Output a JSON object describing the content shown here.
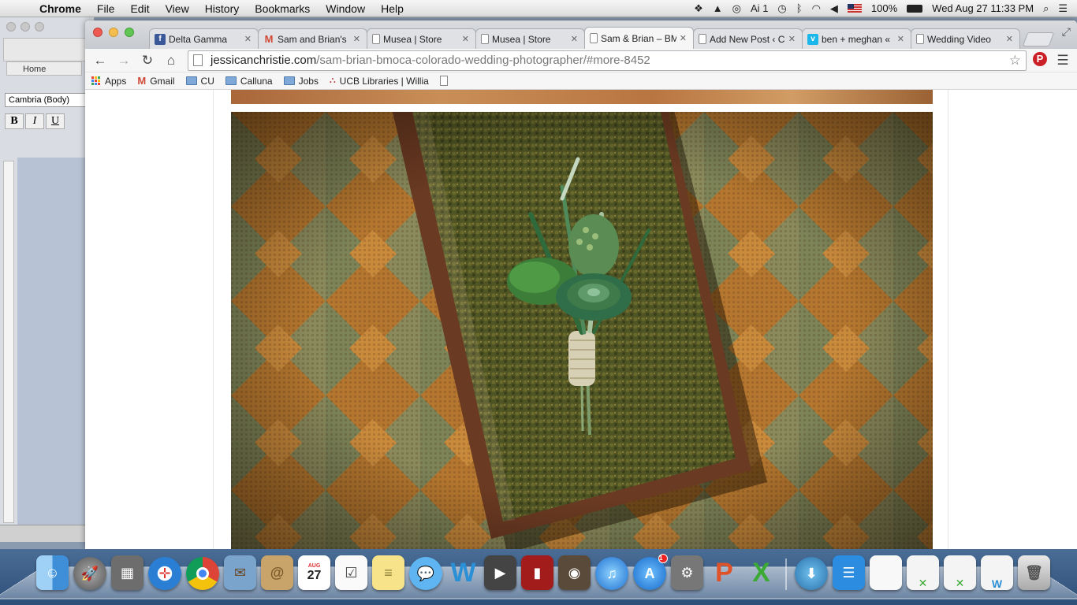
{
  "menubar": {
    "app_name": "Chrome",
    "menus": [
      "File",
      "Edit",
      "View",
      "History",
      "Bookmarks",
      "Window",
      "Help"
    ],
    "adobe_count": "1",
    "battery": "100%",
    "clock": "Wed Aug 27  11:33 PM"
  },
  "word": {
    "home_label": "Home",
    "font_name": "Cambria (Body)",
    "format_buttons": [
      "B",
      "I",
      "U"
    ]
  },
  "tabs": [
    {
      "title": "Delta Gamma",
      "favicon": "facebook-icon",
      "active": false
    },
    {
      "title": "Sam and Brian's",
      "favicon": "gmail-icon",
      "active": false
    },
    {
      "title": "Musea | Store",
      "favicon": "page-icon",
      "active": false
    },
    {
      "title": "Musea | Store",
      "favicon": "page-icon",
      "active": false
    },
    {
      "title": "Sam & Brian – BM",
      "favicon": "page-icon",
      "active": true
    },
    {
      "title": "Add New Post ‹ C",
      "favicon": "page-icon",
      "active": false
    },
    {
      "title": "ben + meghan «",
      "favicon": "vimeo-icon",
      "active": false
    },
    {
      "title": "Wedding Video",
      "favicon": "page-icon",
      "active": false
    }
  ],
  "address": {
    "host": "jessicanchristie.com",
    "path": "/sam-brian-bmoca-colorado-wedding-photographer/#more-8452"
  },
  "bookmarks": [
    {
      "label": "Apps",
      "icon": "apps-grid-icon"
    },
    {
      "label": "Gmail",
      "icon": "gmail-icon"
    },
    {
      "label": "CU",
      "icon": "folder-icon"
    },
    {
      "label": "Calluna",
      "icon": "folder-icon"
    },
    {
      "label": "Jobs",
      "icon": "folder-icon"
    },
    {
      "label": "UCB Libraries | Willia",
      "icon": "ucb-icon"
    },
    {
      "label": "",
      "icon": "page-icon"
    }
  ],
  "colors": {
    "brick_orange": "#b5772f",
    "sage_green": "#7d8458",
    "moss": "#5a5c2a",
    "wood": "#6b3a22",
    "succulent": "#3f7a4a"
  },
  "dock": {
    "calendar_month": "AUG",
    "calendar_day": "27",
    "appstore_badge": "1",
    "apps": [
      "finder-icon",
      "launchpad-icon",
      "image-capture-icon",
      "safari-icon",
      "chrome-icon",
      "mail-icon",
      "contacts-icon",
      "calendar-icon",
      "reminders-icon",
      "notes-icon",
      "messages-icon",
      "word-icon",
      "facetime-icon",
      "photo-booth-icon",
      "iphoto-icon",
      "itunes-icon",
      "app-store-icon",
      "system-preferences-icon",
      "powerpoint-icon",
      "excel-icon",
      "downloads-icon",
      "stacks-icon",
      "document-icon",
      "excel-doc-icon",
      "excel-doc-icon",
      "word-doc-icon",
      "trash-icon"
    ]
  }
}
